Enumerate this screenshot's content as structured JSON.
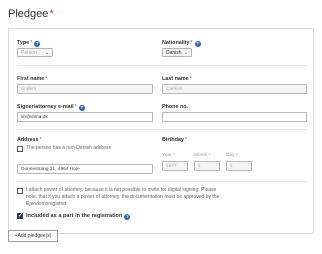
{
  "section": {
    "title": "Pledgee",
    "required_mark": "*"
  },
  "fields": {
    "type": {
      "label": "Type",
      "required": "*",
      "value": "Person"
    },
    "nationality": {
      "label": "Nationality",
      "required": "*",
      "value": "Danish"
    },
    "first_name": {
      "label": "First name",
      "required": "*",
      "value": "Anders"
    },
    "last_name": {
      "label": "Last name",
      "required": "*",
      "value": "Carlsen"
    },
    "email": {
      "label": "Signer/attorney e-mail",
      "required": "*",
      "value": "sh@dima.dk"
    },
    "phone": {
      "label": "Phone no.",
      "value": ""
    },
    "address": {
      "label": "Address",
      "required": "*",
      "value": "Dunnestrang 21, 4964 Hoje"
    },
    "non_danish": {
      "label": "The person has a non-Danish address"
    },
    "birthday": {
      "label": "Birthday",
      "required": "*",
      "year_label": "Year",
      "month_label": "Month",
      "day_label": "Day",
      "year": "1977",
      "month": "1",
      "day": "1"
    }
  },
  "power_of_attorney": {
    "text": "I attach power of attorney, because it is not possible to invite for digital signing. Please note, that if you attach a power of attorney, the documentation must be approved by the Ejendomsregistret."
  },
  "included": {
    "label": "Included as a part in the registration"
  },
  "actions": {
    "add_pledgee": "+Add pledgee(s)"
  },
  "icons": {
    "help": "?",
    "chevron": "⌄",
    "check": "✓"
  },
  "colors": {
    "help_icon": "#1f66c6",
    "required": "#c0392b",
    "checkbox_checked": "#2c3e50"
  }
}
